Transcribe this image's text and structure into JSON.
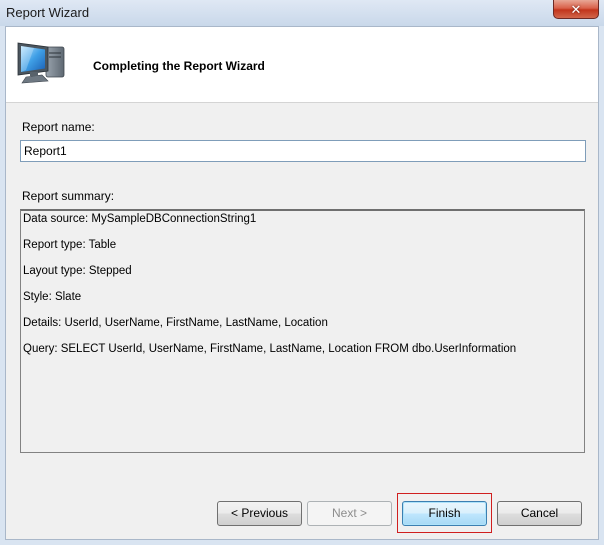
{
  "window": {
    "title": "Report Wizard",
    "close_symbol": "✕"
  },
  "header": {
    "title": "Completing the Report Wizard",
    "icon": "computer-monitor-icon"
  },
  "form": {
    "report_name_label": "Report name:",
    "report_name_value": "Report1",
    "summary_label": "Report summary:"
  },
  "summary": {
    "lines": [
      "Data source: MySampleDBConnectionString1",
      "Report type: Table",
      "Layout type: Stepped",
      "Style: Slate",
      "Details: UserId, UserName, FirstName, LastName, Location",
      "Query:  SELECT UserId, UserName, FirstName, LastName, Location FROM dbo.UserInformation"
    ]
  },
  "buttons": {
    "previous": "< Previous",
    "next": "Next >",
    "finish": "Finish",
    "cancel": "Cancel"
  },
  "colors": {
    "highlight": "#d01f1f",
    "close_button": "#c2351c"
  }
}
